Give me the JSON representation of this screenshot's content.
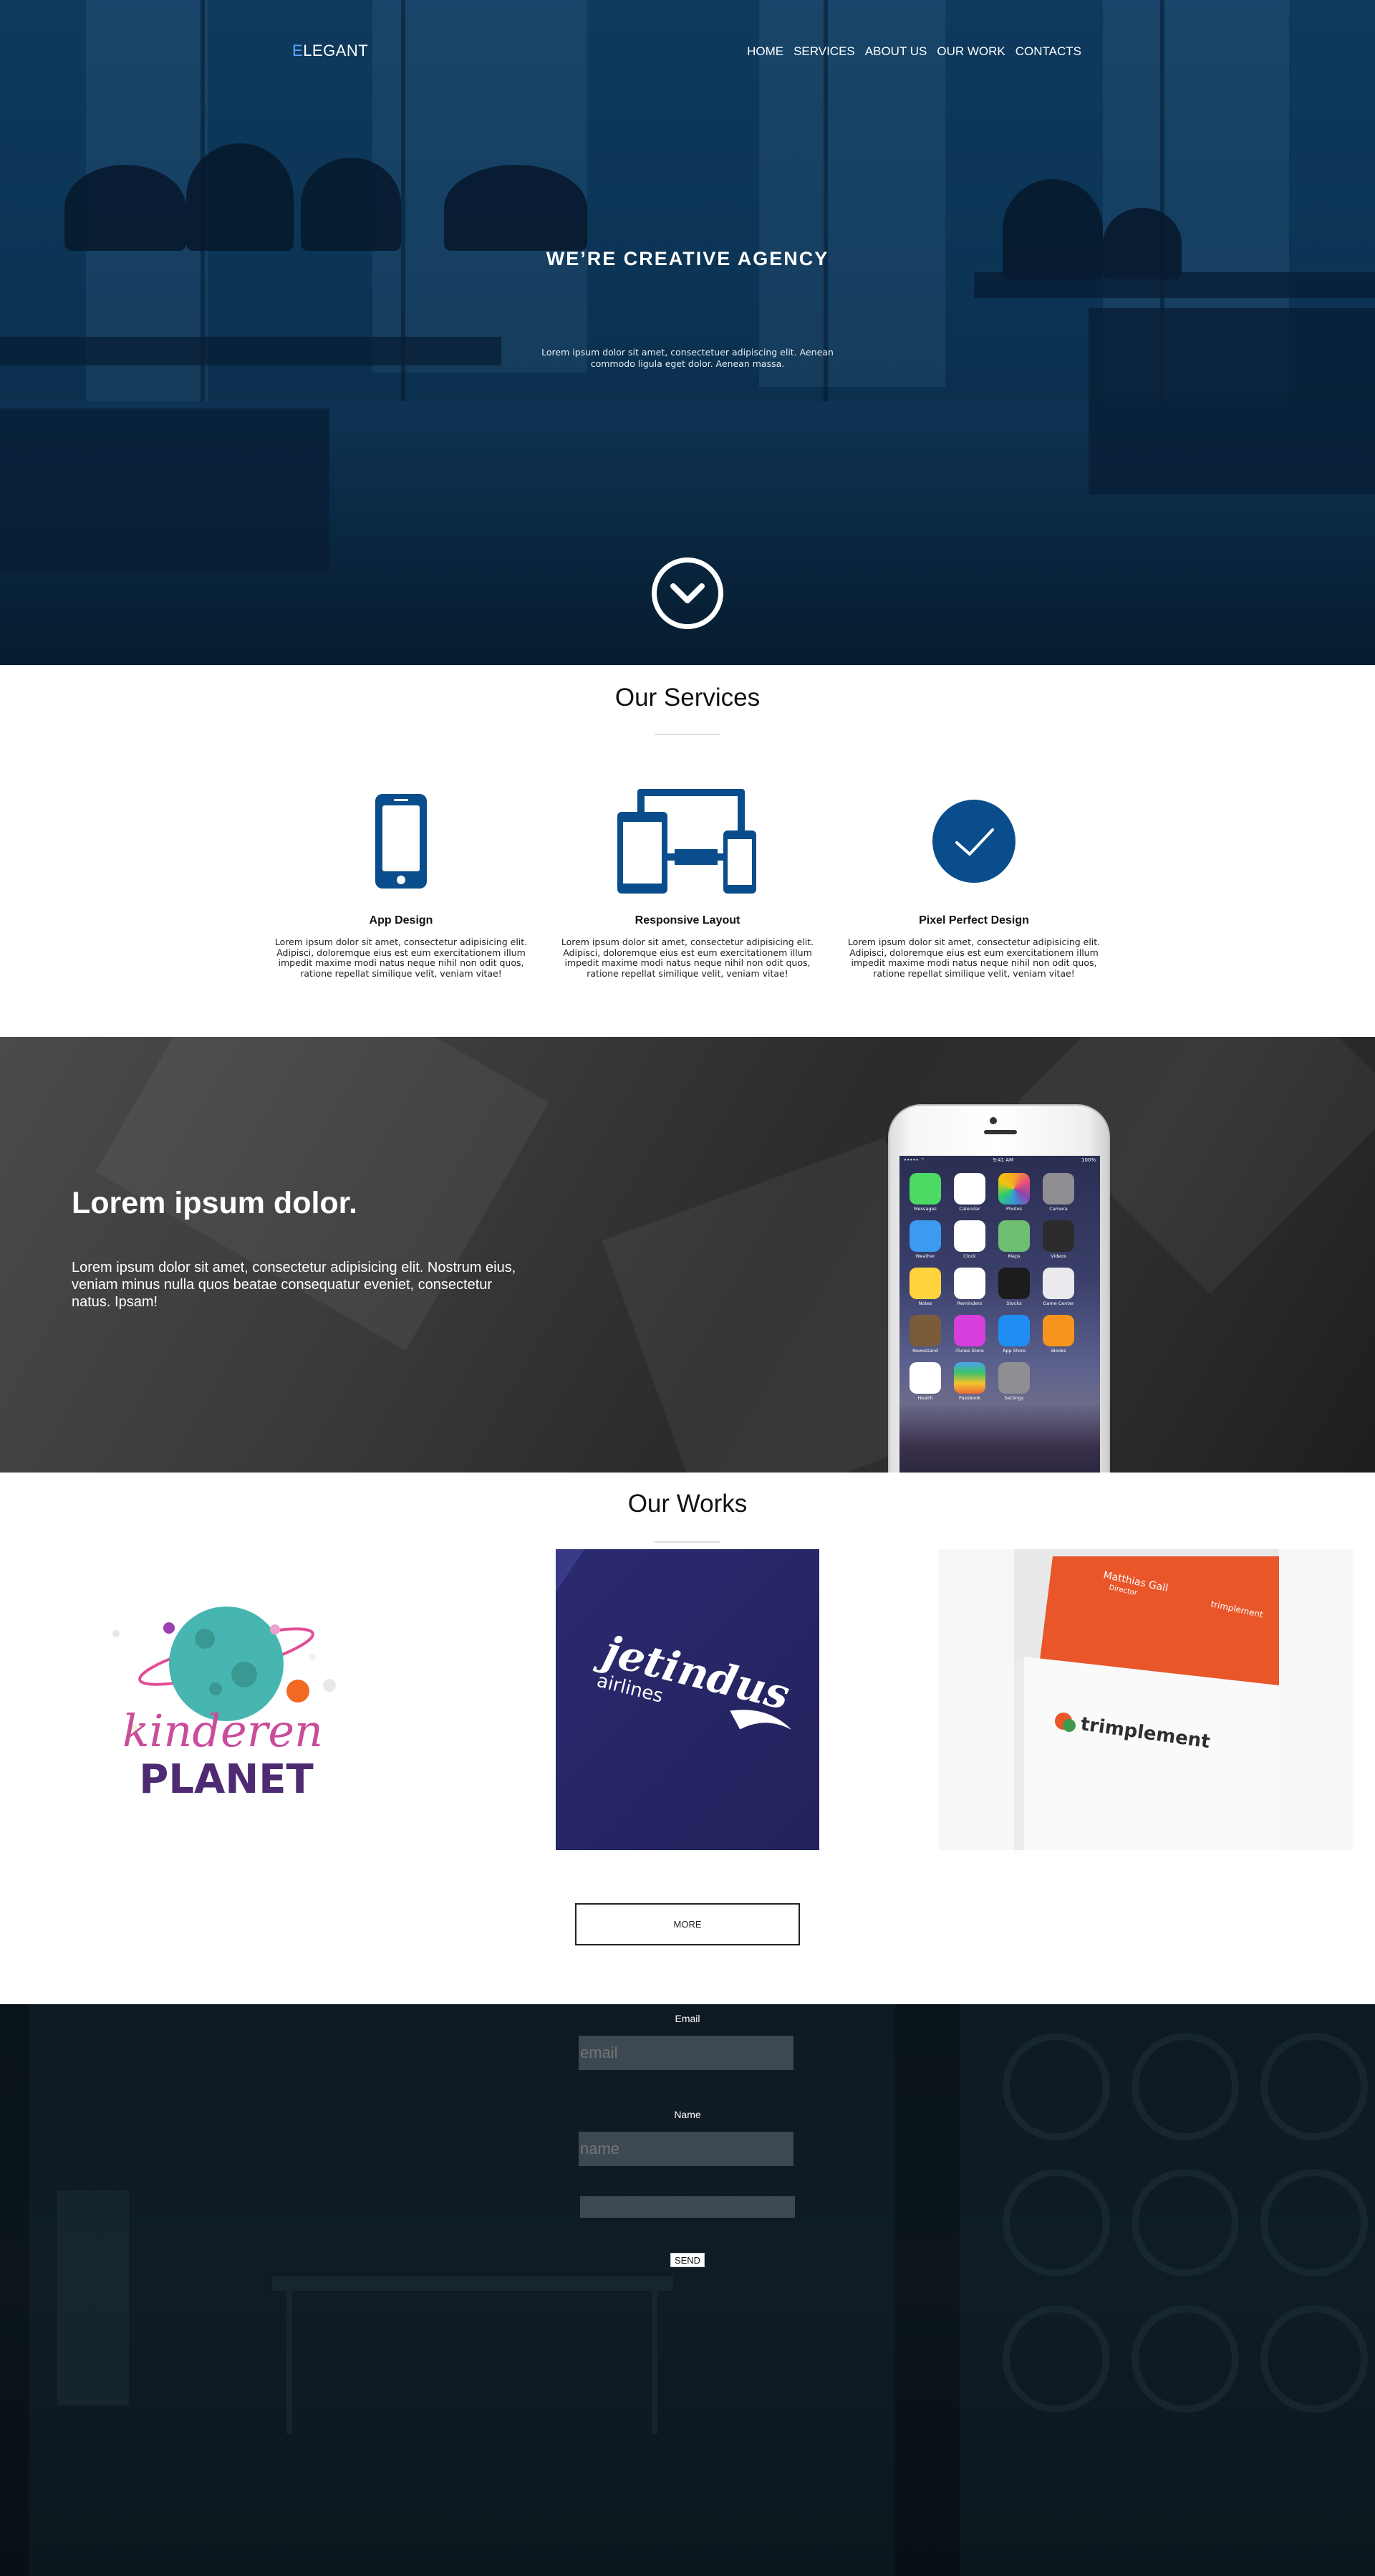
{
  "header": {
    "logo_prefix": "E",
    "logo_rest": "LEGANT",
    "nav": [
      "HOME",
      "SERVICES",
      "ABOUT US",
      "OUR WORK",
      "CONTACTS"
    ]
  },
  "hero": {
    "title": "WE’RE CREATIVE AGENCY",
    "subtitle": "Lorem ipsum dolor sit amet, consectetuer adipiscing elit. Aenean commodo ligula eget dolor. Aenean massa."
  },
  "services": {
    "title": "Our Services",
    "items": [
      {
        "title": "App Design",
        "icon": "mobile-phone-icon",
        "text": "Lorem ipsum dolor sit amet, consectetur adipisicing elit. Adipisci, doloremque eius est eum exercitationem illum impedit maxime modi natus neque nihil non odit quos, ratione repellat similique velit, veniam vitae!"
      },
      {
        "title": "Responsive Layout",
        "icon": "responsive-devices-icon",
        "text": "Lorem ipsum dolor sit amet, consectetur adipisicing elit. Adipisci, doloremque eius est eum exercitationem illum impedit maxime modi natus neque nihil non odit quos, ratione repellat similique velit, veniam vitae!"
      },
      {
        "title": "Pixel Perfect Design",
        "icon": "checkmark-circle-icon",
        "text": "Lorem ipsum dolor sit amet, consectetur adipisicing elit. Adipisci, doloremque eius est eum exercitationem illum impedit maxime modi natus neque nihil non odit quos, ratione repellat similique velit, veniam vitae!"
      }
    ]
  },
  "promo": {
    "title": "Lorem ipsum dolor.",
    "text": "Lorem ipsum dolor sit amet, consectetur adipisicing elit. Nostrum eius, veniam minus nulla quos beatae consequatur eveniet, consectetur natus. Ipsam!",
    "phone_status_left": "••••• ⌔",
    "phone_time": "9:41 AM",
    "phone_battery": "100%",
    "apps": [
      "Messages",
      "Calendar",
      "Photos",
      "Camera",
      "Weather",
      "Clock",
      "Maps",
      "Videos",
      "Notes",
      "Reminders",
      "Stocks",
      "Game Center",
      "Newsstand",
      "iTunes Store",
      "App Store",
      "iBooks",
      "Health",
      "Passbook",
      "Settings",
      ""
    ]
  },
  "works": {
    "title": "Our Works",
    "items": [
      {
        "name": "kinderen-planet",
        "line1": "kinderen",
        "line2": "PLANET"
      },
      {
        "name": "jetindus-airlines",
        "line1": "jetindus",
        "line2": "airlines"
      },
      {
        "name": "trimplement",
        "line1": "trimplement",
        "line2": "trimplement",
        "card_person": "Matthias Gall",
        "card_role": "Director"
      }
    ],
    "more_label": "MORE"
  },
  "contact": {
    "email_label": "Email",
    "email_placeholder": "email",
    "name_label": "Name",
    "name_placeholder": "name",
    "send_label": "SEND"
  },
  "colors": {
    "accent": "#0a4d8c",
    "hero_bg": "#0c3455",
    "promo_bg": "#2c2c2c",
    "contact_bg": "#0d1a23"
  }
}
